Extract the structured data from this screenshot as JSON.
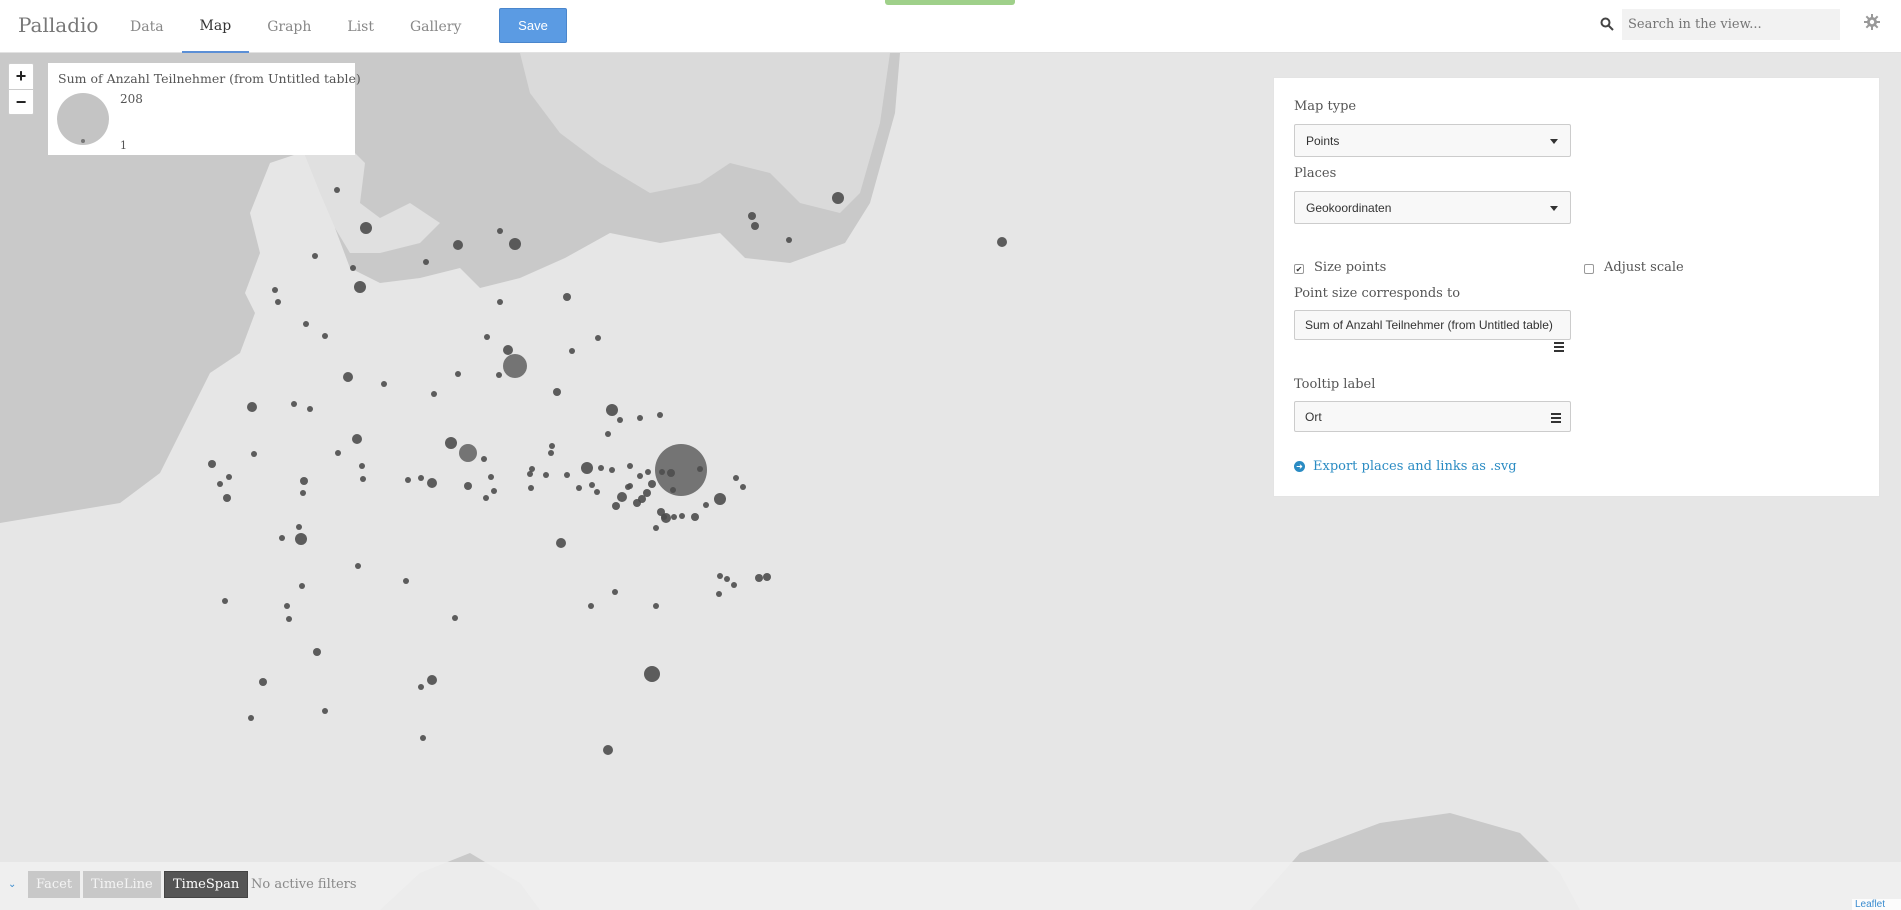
{
  "app": {
    "brand": "Palladio",
    "nav": [
      {
        "label": "Data",
        "active": false
      },
      {
        "label": "Map",
        "active": true
      },
      {
        "label": "Graph",
        "active": false
      },
      {
        "label": "List",
        "active": false
      },
      {
        "label": "Gallery",
        "active": false
      }
    ],
    "save_label": "Save",
    "search_placeholder": "Search in the view..."
  },
  "map": {
    "zoom_in": "+",
    "zoom_out": "−",
    "legend": {
      "title": "Sum of Anzahl Teilnehmer (from Untitled table)",
      "max": "208",
      "min": "1"
    },
    "attribution": "Leaflet",
    "colors": {
      "land": "#e6e6e6",
      "sea": "#c9c9c9",
      "points": "#4d4d4d"
    }
  },
  "settings": {
    "map_type_label": "Map type",
    "map_type_value": "Points",
    "places_label": "Places",
    "places_value": "Geokoordinaten",
    "size_points_label": "Size points",
    "size_points_checked": true,
    "adjust_scale_label": "Adjust scale",
    "adjust_scale_checked": false,
    "point_size_label": "Point size corresponds to",
    "point_size_value": "Sum of Anzahl Teilnehmer (from Untitled table)",
    "tooltip_label": "Tooltip label",
    "tooltip_value": "Ort",
    "export_label": "Export places and links as .svg"
  },
  "filters": {
    "toggle_icon": "chevron-down",
    "buttons": [
      {
        "label": "Facet",
        "state": "disabled"
      },
      {
        "label": "TimeLine",
        "state": "disabled"
      },
      {
        "label": "TimeSpan",
        "state": "active"
      }
    ],
    "status": "No active filters"
  }
}
